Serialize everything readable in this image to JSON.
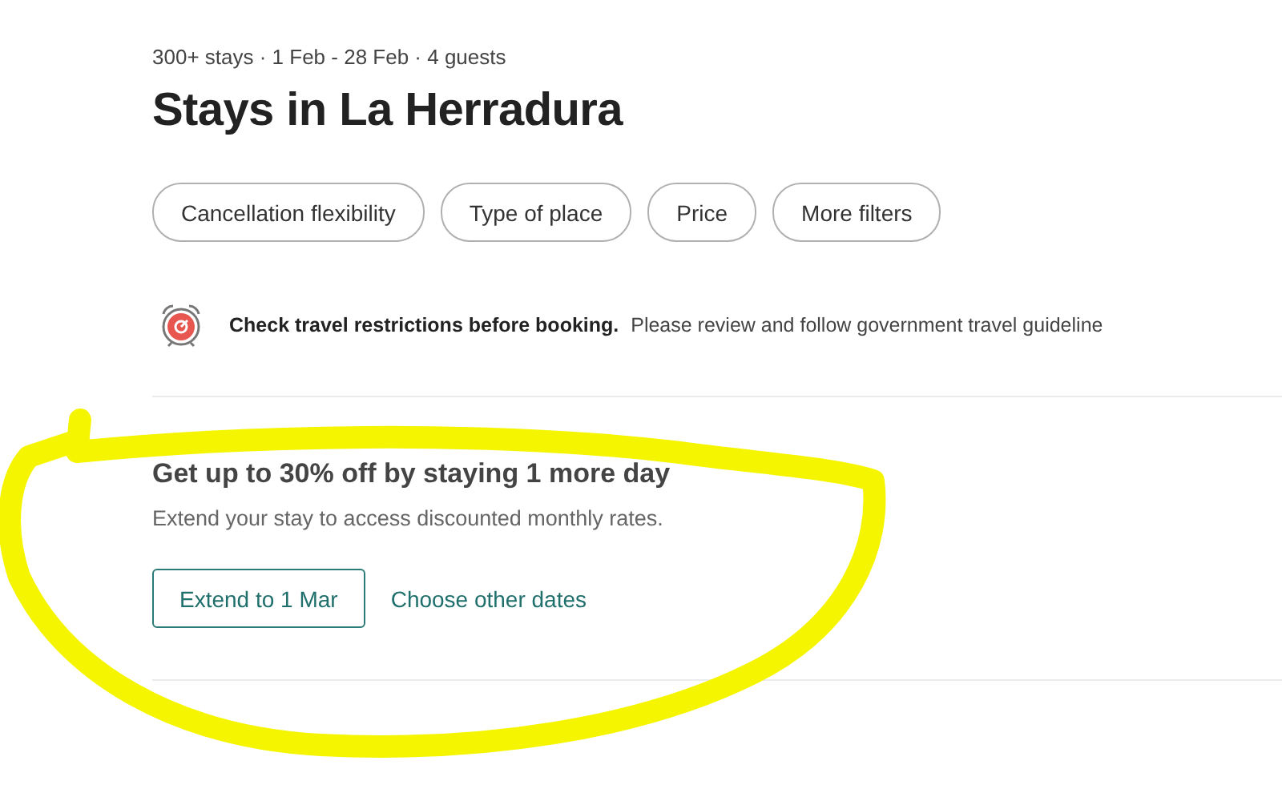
{
  "summary": "300+ stays · 1 Feb - 28 Feb · 4 guests",
  "title": "Stays in La Herradura",
  "filters": [
    {
      "label": "Cancellation flexibility"
    },
    {
      "label": "Type of place"
    },
    {
      "label": "Price"
    },
    {
      "label": "More filters"
    }
  ],
  "notice": {
    "headline": "Check travel restrictions before booking.",
    "text": "Please review and follow government travel guideline"
  },
  "promo": {
    "heading": "Get up to 30% off by staying 1 more day",
    "text": "Extend your stay to access discounted monthly rates.",
    "buttons": [
      {
        "kind": "outlined",
        "label": "Extend to 1 Mar"
      },
      {
        "kind": "link",
        "label": "Choose other dates"
      }
    ]
  }
}
